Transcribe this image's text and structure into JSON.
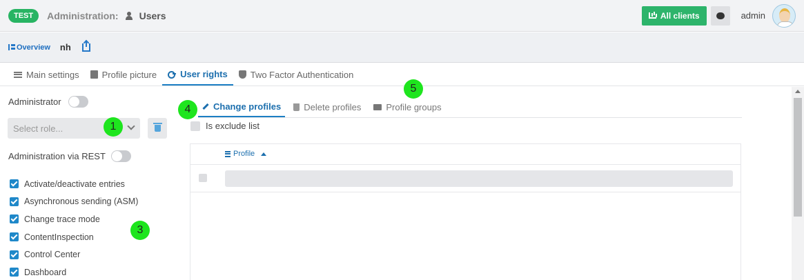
{
  "header": {
    "env_badge": "TEST",
    "section_title": "Administration:",
    "page_title": "Users",
    "all_clients_label": "All clients",
    "username": "admin"
  },
  "subbar": {
    "overview_label": "Overview",
    "record_name": "nh"
  },
  "main_tabs": [
    {
      "label": "Main settings",
      "icon": "list-icon"
    },
    {
      "label": "Profile picture",
      "icon": "portrait-icon"
    },
    {
      "label": "User rights",
      "icon": "key-icon",
      "active": true
    },
    {
      "label": "Two Factor Authentication",
      "icon": "shield-icon"
    }
  ],
  "left": {
    "administrator_label": "Administrator",
    "select_role_placeholder": "Select role...",
    "admin_rest_label": "Administration via REST",
    "permissions": [
      "Activate/deactivate entries",
      "Asynchronous sending (ASM)",
      "Change trace mode",
      "ContentInspection",
      "Control Center",
      "Dashboard"
    ]
  },
  "sub_tabs": [
    {
      "label": "Change profiles",
      "icon": "pencil-icon",
      "active": true
    },
    {
      "label": "Delete profiles",
      "icon": "trash-icon"
    },
    {
      "label": "Profile groups",
      "icon": "folder-open-icon"
    }
  ],
  "exclude_label": "Is exclude list",
  "grid": {
    "column_profile": "Profile"
  },
  "markers": [
    "1",
    "3",
    "4",
    "5"
  ],
  "colors": {
    "accent": "#1c7fc4",
    "success": "#2db46b",
    "marker": "#1ee51e"
  }
}
